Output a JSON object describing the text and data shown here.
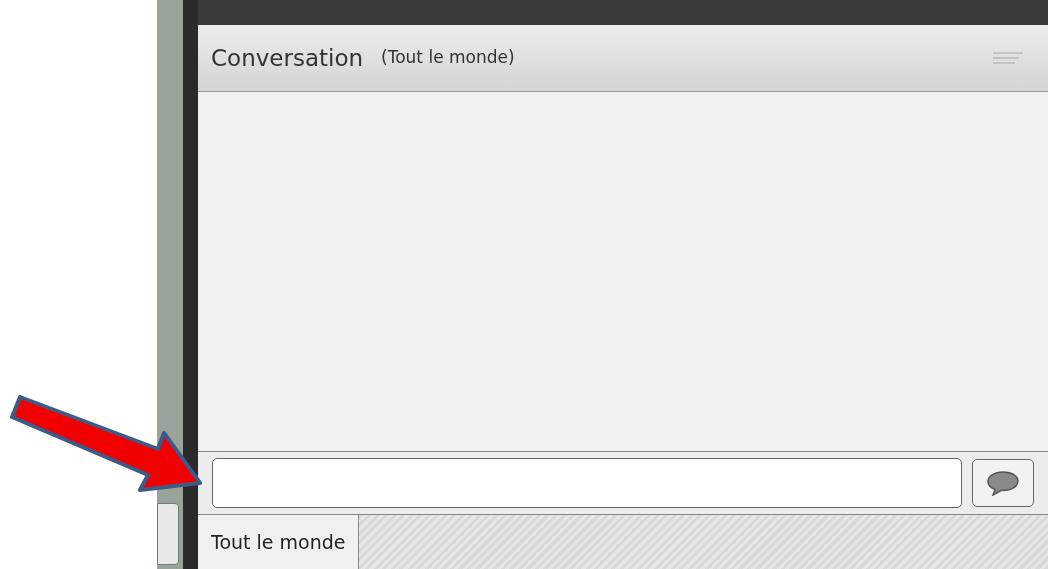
{
  "panel": {
    "title": "Conversation",
    "audience": "(Tout le monde)"
  },
  "tabs": [
    {
      "label": "Tout le monde",
      "selected": true
    }
  ]
}
